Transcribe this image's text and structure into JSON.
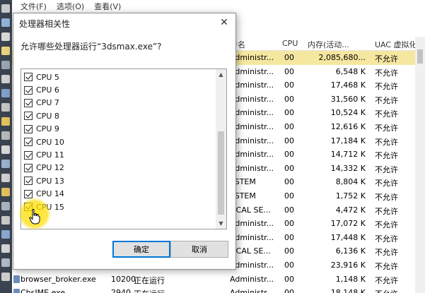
{
  "taskmgr": {
    "menu": [
      "文件(F)",
      "选项(O)",
      "查看(V)"
    ],
    "columns": {
      "user": "户名",
      "cpu": "CPU",
      "mem": "内存(活动...",
      "uac": "UAC 虚拟化"
    },
    "rows": [
      {
        "user": "Administr...",
        "cpu": "00",
        "mem": "2,085,680...",
        "uac": "不允许",
        "highlight": true
      },
      {
        "user": "Administr...",
        "cpu": "00",
        "mem": "6,548 K",
        "uac": "不允许"
      },
      {
        "user": "Administr...",
        "cpu": "00",
        "mem": "17,468 K",
        "uac": "不允许"
      },
      {
        "user": "Administr...",
        "cpu": "00",
        "mem": "31,560 K",
        "uac": "不允许"
      },
      {
        "user": "Administr...",
        "cpu": "00",
        "mem": "10,524 K",
        "uac": "不允许"
      },
      {
        "user": "Administr...",
        "cpu": "00",
        "mem": "12,616 K",
        "uac": "不允许"
      },
      {
        "user": "Administr...",
        "cpu": "00",
        "mem": "17,184 K",
        "uac": "不允许"
      },
      {
        "user": "Administr...",
        "cpu": "00",
        "mem": "14,712 K",
        "uac": "不允许"
      },
      {
        "user": "Administr...",
        "cpu": "00",
        "mem": "14,332 K",
        "uac": "不允许"
      },
      {
        "user": "YSTEM",
        "cpu": "00",
        "mem": "8,804 K",
        "uac": "不允许"
      },
      {
        "user": "YSTEM",
        "cpu": "00",
        "mem": "1,752 K",
        "uac": "不允许"
      },
      {
        "user": "OCAL SE...",
        "cpu": "00",
        "mem": "4,472 K",
        "uac": "不允许"
      },
      {
        "user": "Administr...",
        "cpu": "00",
        "mem": "17,072 K",
        "uac": "不允许"
      },
      {
        "user": "Administr...",
        "cpu": "00",
        "mem": "17,448 K",
        "uac": "不允许"
      },
      {
        "user": "OCAL SE...",
        "cpu": "00",
        "mem": "6,136 K",
        "uac": "不允许"
      },
      {
        "user": "Administr...",
        "cpu": "00",
        "mem": "23,916 K",
        "uac": "不允许"
      },
      {
        "name": "browser_broker.exe",
        "pid": "10200",
        "status": "正在运行",
        "user": "Administr...",
        "cpu": "00",
        "mem": "1,148 K",
        "uac": "不允许"
      },
      {
        "name": "ChsIME.exe",
        "pid": "2940",
        "status": "正在运行",
        "user": "Administr...",
        "cpu": "00",
        "mem": "18,148 K",
        "uac": "不允许"
      }
    ]
  },
  "dialog": {
    "title": "处理器相关性",
    "close_glyph": "✕",
    "prompt": "允许哪些处理器运行“3dsmax.exe”?",
    "cpus": [
      {
        "label": "CPU 5",
        "checked": true
      },
      {
        "label": "CPU 6",
        "checked": true
      },
      {
        "label": "CPU 7",
        "checked": true
      },
      {
        "label": "CPU 8",
        "checked": true
      },
      {
        "label": "CPU 9",
        "checked": true
      },
      {
        "label": "CPU 10",
        "checked": true
      },
      {
        "label": "CPU 11",
        "checked": true
      },
      {
        "label": "CPU 12",
        "checked": true
      },
      {
        "label": "CPU 13",
        "checked": true
      },
      {
        "label": "CPU 14",
        "checked": true
      },
      {
        "label": "CPU 15",
        "checked": true
      }
    ],
    "scroll_up": "▲",
    "scroll_down": "▼",
    "ok_label": "确定",
    "cancel_label": "取消"
  },
  "colors": {
    "row_highlight": "#f6e7a0",
    "default_button_border": "#0078d7",
    "cursor_glow": "#ffe000"
  }
}
